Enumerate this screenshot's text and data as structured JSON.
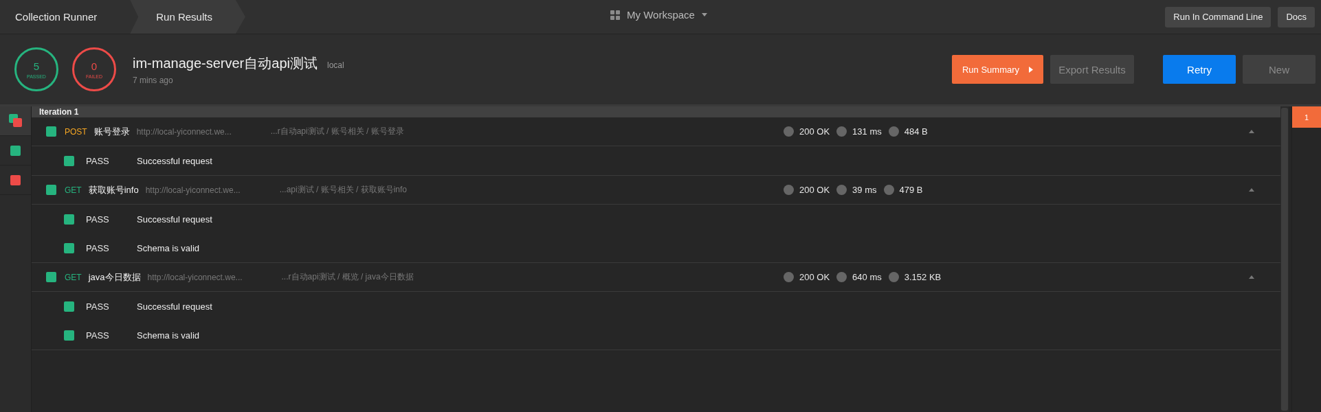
{
  "breadcrumb": [
    {
      "label": "Collection Runner",
      "selected": false
    },
    {
      "label": "Run Results",
      "selected": true
    }
  ],
  "workspace": {
    "label": "My Workspace"
  },
  "top_buttons": [
    "Run In Command Line",
    "Docs"
  ],
  "summary": {
    "passed_count": "5",
    "passed_label": "PASSED",
    "failed_count": "0",
    "failed_label": "FAILED",
    "title": "im-manage-server自动api测试",
    "environment": "local",
    "time": "7 mins ago"
  },
  "actions": [
    {
      "label": "Run Summary",
      "kind": "primary-arrow",
      "disabled": false
    },
    {
      "label": "Export Results",
      "kind": "secondary",
      "disabled": true
    },
    {
      "label": "Retry",
      "kind": "blue",
      "disabled": false
    },
    {
      "label": "New",
      "kind": "secondary",
      "disabled": true
    }
  ],
  "filters": [
    {
      "kind": "all",
      "selected": true
    },
    {
      "kind": "passed",
      "selected": false
    },
    {
      "kind": "failed",
      "selected": false
    }
  ],
  "iteration": {
    "label": "Iteration 1"
  },
  "requests": [
    {
      "passed": true,
      "method": "POST",
      "color": "#f5a623",
      "name": "账号登录",
      "url": "http://local-yiconnect.we...",
      "path": "...r自动api测试 / 账号相关 / 账号登录",
      "status": "200 OK",
      "time": "131 ms",
      "size": "484 B",
      "expanded": true,
      "tests": [
        {
          "passed": true,
          "result": "PASS",
          "name": "Successful request"
        }
      ]
    },
    {
      "passed": true,
      "method": "GET",
      "color": "#26b47f",
      "name": "获取账号info",
      "url": "http://local-yiconnect.we...",
      "path": "...api测试 / 账号相关 / 获取账号info",
      "status": "200 OK",
      "time": "39 ms",
      "size": "479 B",
      "expanded": true,
      "tests": [
        {
          "passed": true,
          "result": "PASS",
          "name": "Successful request"
        },
        {
          "passed": true,
          "result": "PASS",
          "name": "Schema is valid"
        }
      ]
    },
    {
      "passed": true,
      "method": "GET",
      "color": "#26b47f",
      "name": "java今日数据",
      "url": "http://local-yiconnect.we...",
      "path": "...r自动api测试 / 概览 / java今日数据",
      "status": "200 OK",
      "time": "640 ms",
      "size": "3.152 KB",
      "expanded": true,
      "tests": [
        {
          "passed": true,
          "result": "PASS",
          "name": "Successful request"
        },
        {
          "passed": true,
          "result": "PASS",
          "name": "Schema is valid"
        }
      ]
    }
  ],
  "iterations": [
    {
      "label": "1",
      "selected": true
    }
  ]
}
